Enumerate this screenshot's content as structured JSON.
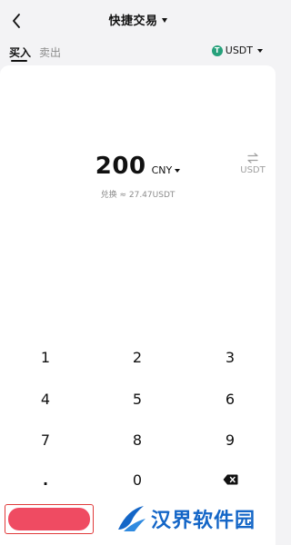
{
  "header": {
    "title": "快捷交易"
  },
  "tabs": {
    "buy_label": "买入",
    "sell_label": "卖出",
    "coin_label": "USDT",
    "coin_icon_letter": "T"
  },
  "amount": {
    "value": "200",
    "currency": "CNY",
    "conversion": "兑换 ≈ 27.47USDT",
    "switch_label": "USDT"
  },
  "keypad": {
    "keys": [
      "1",
      "2",
      "3",
      "4",
      "5",
      "6",
      "7",
      "8",
      "9",
      ".",
      "0"
    ]
  },
  "watermark": {
    "text": "汉界软件园"
  },
  "colors": {
    "accent": "#ef4b62",
    "tether": "#26a17b",
    "watermark": "#1466c7"
  }
}
